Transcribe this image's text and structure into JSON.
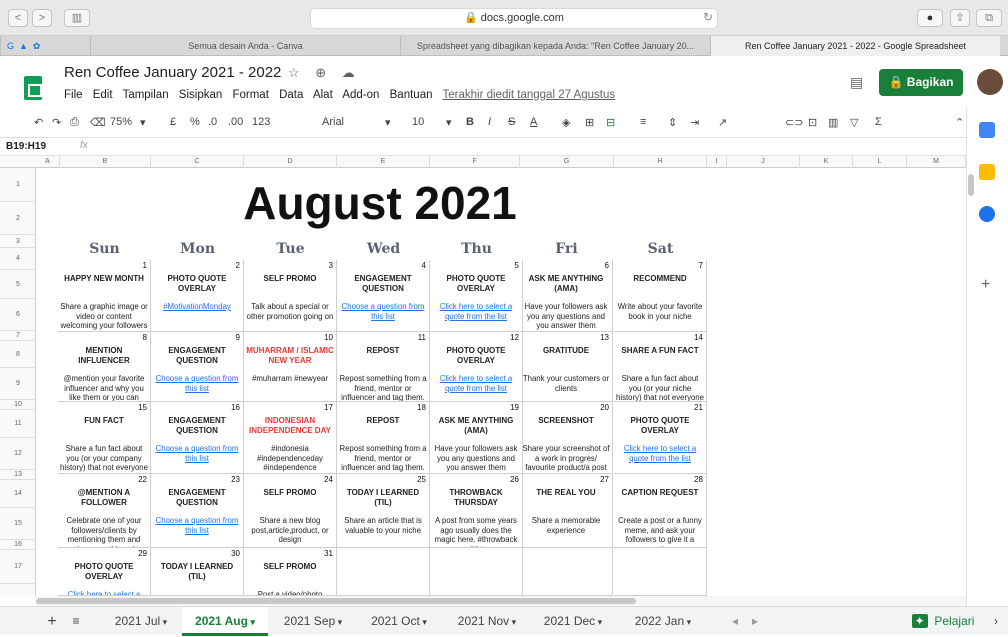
{
  "browser": {
    "url": "docs.google.com",
    "nav_back": "<",
    "nav_fwd": ">",
    "sidebar": "▥"
  },
  "tabs": [
    "Semua desain Anda - Canva",
    "Spreadsheet yang dibagikan kepada Anda: \"Ren Coffee January 20...",
    "Ren Coffee January 2021 - 2022 - Google Spreadsheet"
  ],
  "doc": {
    "title": "Ren Coffee January 2021 - 2022",
    "menu": [
      "File",
      "Edit",
      "Tampilan",
      "Sisipkan",
      "Format",
      "Data",
      "Alat",
      "Add-on",
      "Bantuan"
    ],
    "last_edit": "Terakhir diedit tanggal 27 Agustus",
    "share": "Bagikan"
  },
  "toolbar": {
    "zoom": "75%",
    "currency": "£",
    "percent": "%",
    "dec1": ".0",
    "dec2": ".00",
    "numfmt": "123",
    "font": "Arial",
    "size": "10",
    "bold": "B",
    "italic": "I",
    "strike": "S",
    "color": "A"
  },
  "formula": {
    "cellref": "B19:H19",
    "fx": "fx",
    "value": ""
  },
  "columns": [
    "A",
    "B",
    "C",
    "D",
    "E",
    "F",
    "G",
    "H",
    "I",
    "J",
    "K",
    "L",
    "M"
  ],
  "rows": [
    "1",
    "2",
    "3",
    "4",
    "5",
    "6",
    "7",
    "8",
    "9",
    "10",
    "11",
    "12",
    "13",
    "14",
    "15",
    "16",
    "17"
  ],
  "calendar": {
    "title": "August 2021",
    "days": [
      "Sun",
      "Mon",
      "Tue",
      "Wed",
      "Thu",
      "Fri",
      "Sat"
    ],
    "weeks": [
      [
        {
          "n": "1",
          "t": "HAPPY NEW MONTH",
          "b": "Share a graphic image or video or content welcoming your followers to the new"
        },
        {
          "n": "2",
          "t": "PHOTO QUOTE OVERLAY",
          "b": "#MotivationMonday",
          "link": true
        },
        {
          "n": "3",
          "t": "SELF PROMO",
          "b": "Talk about a special or other promotion going on"
        },
        {
          "n": "4",
          "t": "ENGAGEMENT QUESTION",
          "b": "Choose a question from this list",
          "link": true
        },
        {
          "n": "5",
          "t": "PHOTO QUOTE OVERLAY",
          "b": "Click here to select a quote from the list",
          "link": true
        },
        {
          "n": "6",
          "t": "ASK ME ANYTHING (AMA)",
          "b": "Have your followers ask you any questions and you answer them"
        },
        {
          "n": "7",
          "t": "RECOMMEND",
          "b": "Write about your favorite book in your niche"
        }
      ],
      [
        {
          "n": "8",
          "t": "MENTION INFLUENCER",
          "b": "@mention your favorite influencer and why you like them or you can include them in a picture"
        },
        {
          "n": "9",
          "t": "ENGAGEMENT QUESTION",
          "b": "Choose a question from this list",
          "link": true
        },
        {
          "n": "10",
          "t": "MUHARRAM / ISLAMIC NEW YEAR",
          "b": "#muharram #newyear",
          "red": true
        },
        {
          "n": "11",
          "t": "REPOST",
          "b": "Repost something from a friend, mentor or influencer and tag them."
        },
        {
          "n": "12",
          "t": "PHOTO QUOTE OVERLAY",
          "b": "Click here to select a quote from the list",
          "link": true
        },
        {
          "n": "13",
          "t": "GRATITUDE",
          "b": "Thank your customers or clients"
        },
        {
          "n": "14",
          "t": "SHARE A FUN FACT",
          "b": "Share a fun fact about you (or your niche history) that not everyone knows and allows your audience to"
        }
      ],
      [
        {
          "n": "15",
          "t": "FUN FACT",
          "b": "Share a fun fact about you (or your company history) that not everyone knows and"
        },
        {
          "n": "16",
          "t": "ENGAGEMENT QUESTION",
          "b": "Choose a question from this list",
          "link": true
        },
        {
          "n": "17",
          "t": "INDONESIAN INDEPENDENCE DAY",
          "b": "#indonesia #independenceday #independence",
          "red": true
        },
        {
          "n": "18",
          "t": "REPOST",
          "b": "Repost something from a friend, mentor or influencer and tag them."
        },
        {
          "n": "19",
          "t": "ASK ME ANYTHING (AMA)",
          "b": "Have your followers ask you any questions and you answer them"
        },
        {
          "n": "20",
          "t": "SCREENSHOT",
          "b": "Share your screenshot of a work in progres/ favourite product/a post or meme you find"
        },
        {
          "n": "21",
          "t": "PHOTO QUOTE OVERLAY",
          "b": "Click here to select a quote from the list",
          "link": true
        }
      ],
      [
        {
          "n": "22",
          "t": "@MENTION A FOLLOWER",
          "b": "Celebrate one of your followers/clients by mentioning them and saying something nice"
        },
        {
          "n": "23",
          "t": "ENGAGEMENT QUESTION",
          "b": "Choose a question from this list",
          "link": true
        },
        {
          "n": "24",
          "t": "SELF PROMO",
          "b": "Share a new blog post,article,product, or design"
        },
        {
          "n": "25",
          "t": "TODAY I LEARNED (TIL)",
          "b": "Share an article that is valuable to your niche"
        },
        {
          "n": "26",
          "t": "THROWBACK THURSDAY",
          "b": "A post from some years ago usually does the magic here. #throwback #tbt"
        },
        {
          "n": "27",
          "t": "THE REAL YOU",
          "b": "Share a memorable experience"
        },
        {
          "n": "28",
          "t": "CAPTION REQUEST",
          "b": "Create a post or a funny meme, and ask your followers to give it a caption"
        }
      ],
      [
        {
          "n": "29",
          "t": "PHOTO QUOTE OVERLAY",
          "b": "Click here to select a quote",
          "link": true
        },
        {
          "n": "30",
          "t": "TODAY I LEARNED (TIL)",
          "b": ""
        },
        {
          "n": "31",
          "t": "SELF PROMO",
          "b": "Post a video/photo"
        },
        {
          "n": "",
          "t": "",
          "b": ""
        },
        {
          "n": "",
          "t": "",
          "b": ""
        },
        {
          "n": "",
          "t": "",
          "b": ""
        },
        {
          "n": "",
          "t": "",
          "b": ""
        }
      ]
    ]
  },
  "sheets": [
    "2021 Jul",
    "2021 Aug",
    "2021 Sep",
    "2021 Oct",
    "2021 Nov",
    "2021 Dec",
    "2022 Jan"
  ],
  "active_sheet": "2021 Aug",
  "explore": "Pelajari"
}
